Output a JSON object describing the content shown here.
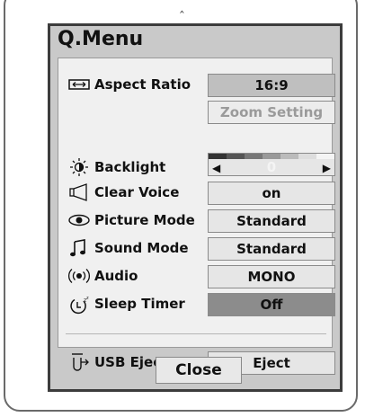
{
  "menu": {
    "title": "Q.Menu",
    "close_label": "Close"
  },
  "items": [
    {
      "label": "Aspect Ratio",
      "icon": "aspect-ratio-icon",
      "value": "16:9",
      "state": "selected"
    },
    {
      "label": "",
      "icon": "",
      "value": "Zoom Setting",
      "state": "disabled"
    },
    {
      "label": "Backlight",
      "icon": "backlight-icon",
      "value": "0",
      "state": "slider"
    },
    {
      "label": "Clear Voice",
      "icon": "clear-voice-icon",
      "value": "on",
      "state": "normal"
    },
    {
      "label": "Picture Mode",
      "icon": "picture-mode-icon",
      "value": "Standard",
      "state": "normal"
    },
    {
      "label": "Sound Mode",
      "icon": "sound-mode-icon",
      "value": "Standard",
      "state": "normal"
    },
    {
      "label": "Audio",
      "icon": "audio-icon",
      "value": "MONO",
      "state": "normal"
    },
    {
      "label": "Sleep Timer",
      "icon": "sleep-timer-icon",
      "value": "Off",
      "state": "highlighted"
    },
    {
      "label": "USB Eject",
      "icon": "usb-eject-icon",
      "value": "Eject",
      "state": "normal"
    }
  ],
  "slider": {
    "left_arrow": "◀",
    "right_arrow": "▶",
    "level": 0
  },
  "colors": {
    "window_bg": "#c9c9c9",
    "panel_bg": "#f0f0f0",
    "selected_bg": "#bfbfbf",
    "highlight_bg": "#8c8c8c"
  }
}
